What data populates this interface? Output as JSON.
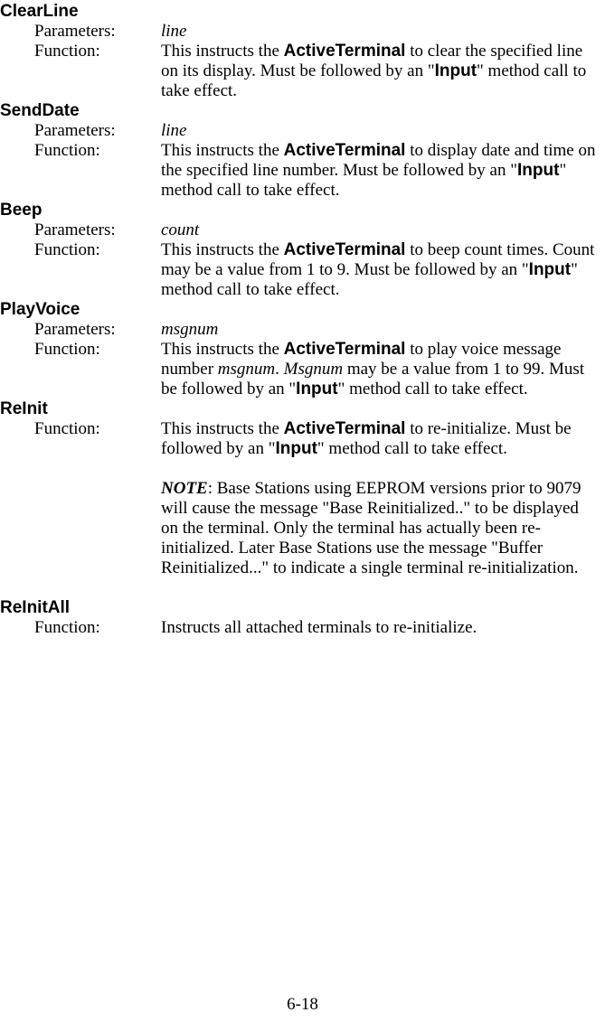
{
  "labels": {
    "parameters": "Parameters:",
    "function": "Function:"
  },
  "methods": {
    "clearLine": {
      "name": "ClearLine",
      "params": "line",
      "func_pre": "This instructs the ",
      "func_bold": "ActiveTerminal",
      "func_post1": " to clear the specified line on its display. Must be followed by an \"",
      "func_bold2": "Input",
      "func_post2": "\" method call to take effect."
    },
    "sendDate": {
      "name": "SendDate",
      "params": "line",
      "func_pre": "This instructs the ",
      "func_bold": "ActiveTerminal",
      "func_post1": " to display date and time on the specified line number. Must be followed by an \"",
      "func_bold2": "Input",
      "func_post2": "\" method call to take effect."
    },
    "beep": {
      "name": "Beep",
      "params": "count",
      "func_pre": "This instructs the ",
      "func_bold": "ActiveTerminal",
      "func_post1": " to beep count times. Count may be a value from 1 to 9. Must be followed by an \"",
      "func_bold2": "Input",
      "func_post2": "\" method call to take effect."
    },
    "playVoice": {
      "name": "PlayVoice",
      "params": "msgnum",
      "func_pre": "This instructs the ",
      "func_bold": "ActiveTerminal",
      "func_post1a": " to play voice message number ",
      "func_italic1": "msgnum",
      "func_post1b": ". ",
      "func_italic2": "Msgnum",
      "func_post1c": " may be a value from 1 to 99. Must be followed by an \"",
      "func_bold2": "Input",
      "func_post2": "\" method call to take effect."
    },
    "reInit": {
      "name": "ReInit",
      "func_pre": "This instructs the ",
      "func_bold": "ActiveTerminal",
      "func_post1": " to re-initialize. Must be followed by an \"",
      "func_bold2": "Input",
      "func_post2": "\" method call to take effect.",
      "note_label": "NOTE",
      "note_text": ": Base Stations using EEPROM versions prior to 9079 will cause the message \"Base Reinitialized..\" to be displayed on the terminal. Only the terminal has actually been re-initialized. Later Base Stations use the message \"Buffer Reinitialized...\" to indicate a single terminal re-initialization."
    },
    "reInitAll": {
      "name": "ReInitAll",
      "func": "Instructs all attached terminals to re-initialize."
    }
  },
  "pageNumber": "6-18"
}
